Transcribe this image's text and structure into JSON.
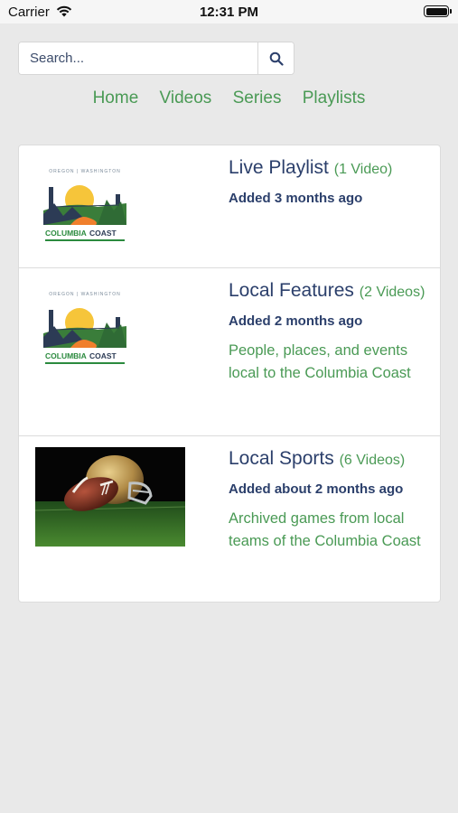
{
  "status_bar": {
    "carrier": "Carrier",
    "time": "12:31 PM"
  },
  "search": {
    "placeholder": "Search..."
  },
  "nav": {
    "items": [
      "Home",
      "Videos",
      "Series",
      "Playlists"
    ]
  },
  "playlists": [
    {
      "title": "Live Playlist",
      "count": "(1 Video)",
      "added": "Added 3 months ago",
      "description": "",
      "thumb_logo": {
        "top": "OREGON | WASHINGTON",
        "brand_a": "COLUMBIA",
        "brand_b": "COAST"
      }
    },
    {
      "title": "Local Features",
      "count": "(2 Videos)",
      "added": "Added 2 months ago",
      "description": "People, places, and events local to the Columbia Coast",
      "thumb_logo": {
        "top": "OREGON | WASHINGTON",
        "brand_a": "COLUMBIA",
        "brand_b": "COAST"
      }
    },
    {
      "title": "Local Sports",
      "count": "(6 Videos)",
      "added": "Added about 2 months ago",
      "description": "Archived games from local teams of the Columbia Coast"
    }
  ],
  "colors": {
    "accent_green": "#4a9a55",
    "navy": "#2b3f6b",
    "background": "#e9e9e9"
  }
}
